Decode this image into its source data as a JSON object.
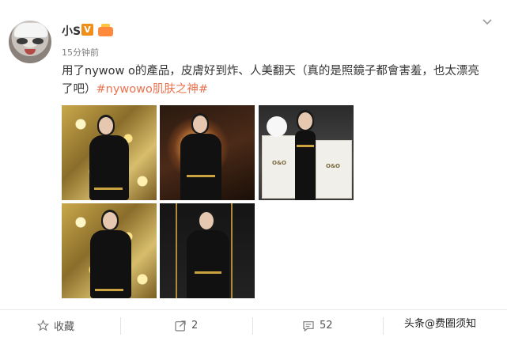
{
  "post": {
    "username": "小S",
    "verified_badge": "V",
    "timestamp": "15分钟前",
    "text_main": "用了nywow o的產品，皮膚好到炸、人美翻天（真的是照鏡子都會害羞，也太漂亮了吧）",
    "hashtag": "#nywowo肌肤之神#"
  },
  "photos": [
    {
      "name": "photo-gold-sequin-portrait-1"
    },
    {
      "name": "photo-dark-backdrop-portrait"
    },
    {
      "name": "photo-product-boxes"
    },
    {
      "name": "photo-gold-sequin-portrait-2"
    },
    {
      "name": "photo-black-wall-portrait"
    }
  ],
  "product_box_label": "O&O",
  "footer": {
    "favorite_label": "收藏",
    "repost_count": "2",
    "comment_count": "52"
  },
  "watermark": "头条@费圈须知",
  "colors": {
    "accent": "#eb7350",
    "vip_badge": "#f08e1a",
    "text": "#333333",
    "muted": "#808080"
  },
  "icons": {
    "menu": "chevron-down-icon",
    "favorite": "star-icon",
    "repost": "repost-icon",
    "comment": "comment-icon"
  }
}
